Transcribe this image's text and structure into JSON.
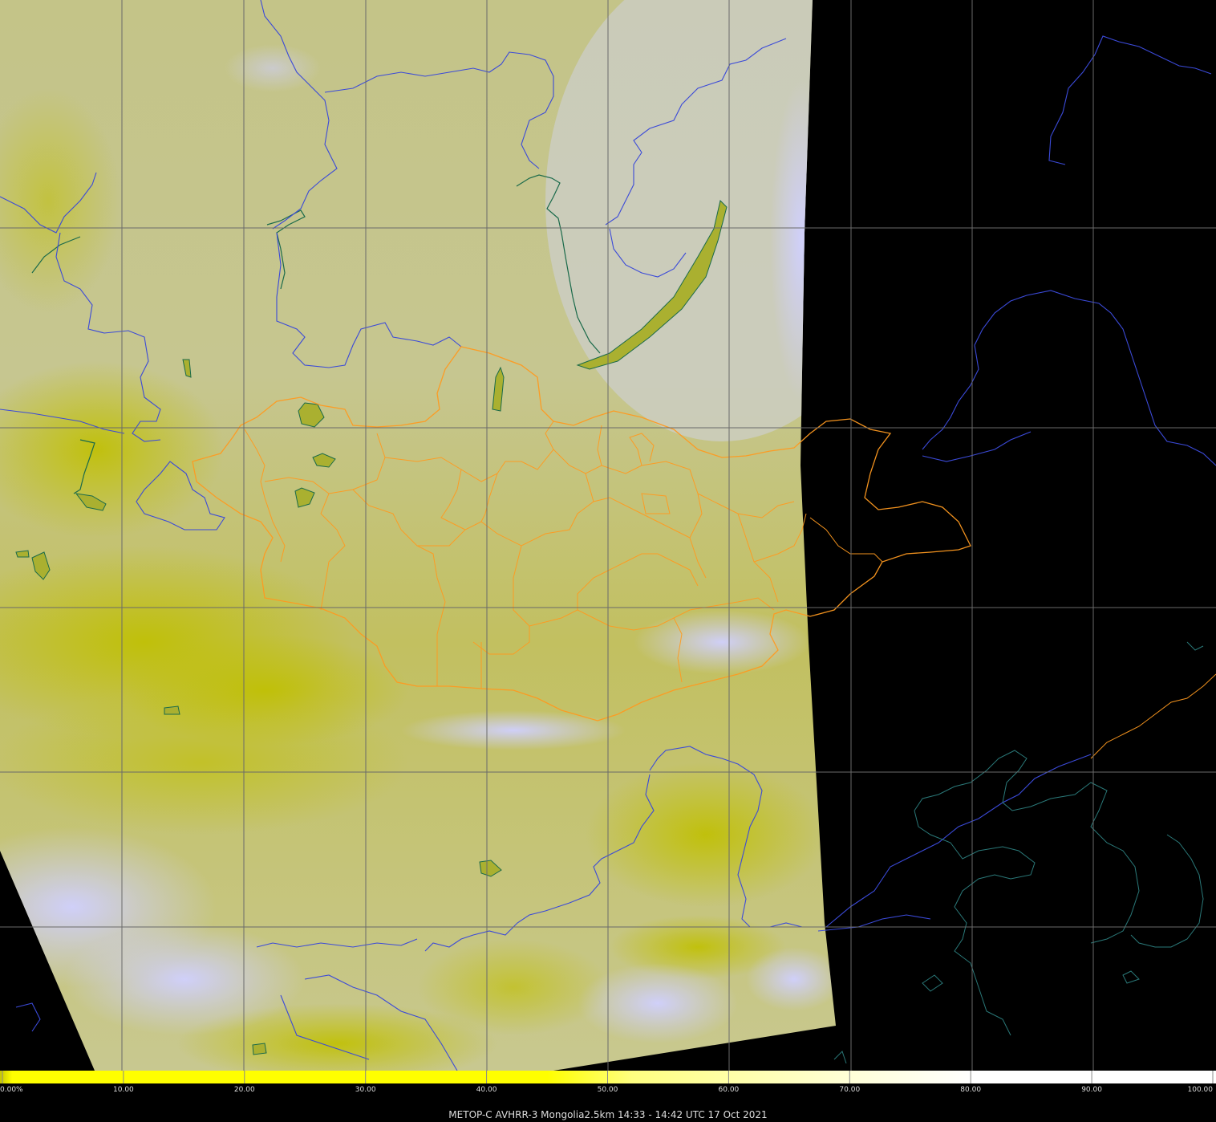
{
  "caption": "METOP-C AVHRR-3 Mongolia2.5km 14:33 - 14:42 UTC 17 Oct 2021",
  "colorbar": {
    "min": 0,
    "max": 100,
    "ticks": [
      "0.00%",
      "10.00",
      "20.00",
      "30.00",
      "40.00",
      "50.00",
      "60.00",
      "70.00",
      "80.00",
      "90.00",
      "100.00"
    ],
    "colors": {
      "low": "#ffff00",
      "mid": "#ffffb4",
      "high": "#ffffff"
    }
  },
  "map": {
    "colors": {
      "background": "#000000",
      "swath": "#c8c890",
      "cloud": "#c8c8ff",
      "dense_yellow": "#c8c800",
      "grid": "#6e6e6e",
      "coastline": "#2a7a7a",
      "country_border": "#3c4cd8",
      "province_border": "#ff9a20",
      "lake": "#a8b030"
    }
  }
}
